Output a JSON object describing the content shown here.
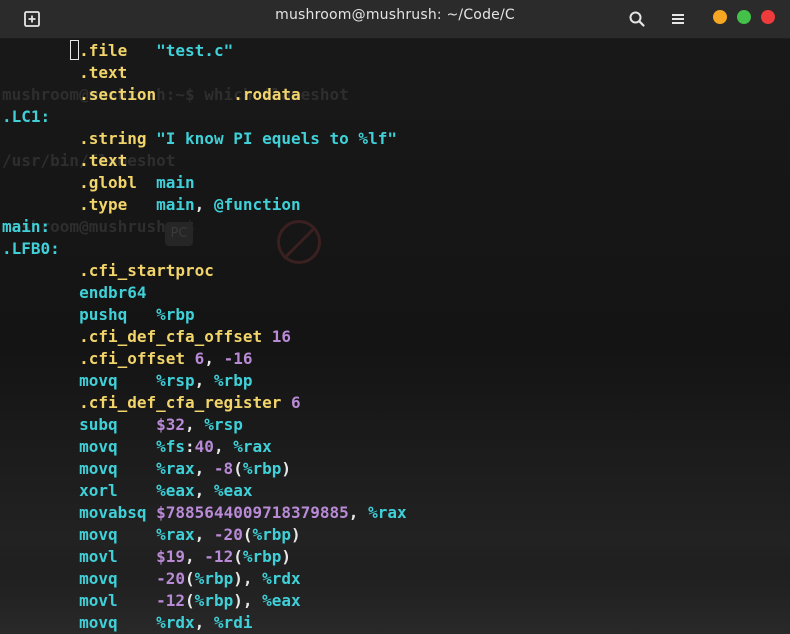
{
  "window": {
    "title": "mushroom@mushrush: ~/Code/C",
    "accent_colors": {
      "minimize": "#f5a623",
      "maximize": "#44c148",
      "close": "#ee3b3b"
    },
    "icons": [
      "new-tab-icon",
      "search-icon",
      "hamburger-menu-icon"
    ]
  },
  "terminal": {
    "background_ghost_text": [
      "mushroom@mushrush:~$ which flameshot",
      "/usr/bin/flameshot",
      "mushroom@mushrush:~$"
    ],
    "lines": [
      [
        [
          "        ",
          "pun"
        ],
        [
          ".file",
          "dir"
        ],
        [
          "   ",
          "pun"
        ],
        [
          "\"test.c\"",
          "str"
        ]
      ],
      [
        [
          "        ",
          "pun"
        ],
        [
          ".text",
          "dir"
        ]
      ],
      [
        [
          "        ",
          "pun"
        ],
        [
          ".section",
          "dir"
        ],
        [
          "        ",
          "pun"
        ],
        [
          ".rodata",
          "dir"
        ]
      ],
      [
        [
          ".LC1:",
          "lab"
        ]
      ],
      [
        [
          "        ",
          "pun"
        ],
        [
          ".string",
          "dir"
        ],
        [
          " ",
          "pun"
        ],
        [
          "\"I know PI equels to %lf\"",
          "str"
        ]
      ],
      [
        [
          "        ",
          "pun"
        ],
        [
          ".text",
          "dir"
        ]
      ],
      [
        [
          "        ",
          "pun"
        ],
        [
          ".globl",
          "dir"
        ],
        [
          "  ",
          "pun"
        ],
        [
          "main",
          "lab"
        ]
      ],
      [
        [
          "        ",
          "pun"
        ],
        [
          ".type",
          "dir"
        ],
        [
          "   ",
          "pun"
        ],
        [
          "main",
          "lab"
        ],
        [
          ", ",
          "pun"
        ],
        [
          "@function",
          "reg"
        ]
      ],
      [
        [
          "main:",
          "lab"
        ]
      ],
      [
        [
          ".LFB0:",
          "lab"
        ]
      ],
      [
        [
          "        ",
          "pun"
        ],
        [
          ".cfi_startproc",
          "dir"
        ]
      ],
      [
        [
          "        ",
          "pun"
        ],
        [
          "endbr64",
          "ins"
        ]
      ],
      [
        [
          "        ",
          "pun"
        ],
        [
          "pushq",
          "ins"
        ],
        [
          "   ",
          "pun"
        ],
        [
          "%rbp",
          "reg"
        ]
      ],
      [
        [
          "        ",
          "pun"
        ],
        [
          ".cfi_def_cfa_offset",
          "dir"
        ],
        [
          " ",
          "pun"
        ],
        [
          "16",
          "num"
        ]
      ],
      [
        [
          "        ",
          "pun"
        ],
        [
          ".cfi_offset",
          "dir"
        ],
        [
          " ",
          "pun"
        ],
        [
          "6",
          "num"
        ],
        [
          ", ",
          "pun"
        ],
        [
          "-16",
          "num"
        ]
      ],
      [
        [
          "        ",
          "pun"
        ],
        [
          "movq",
          "ins"
        ],
        [
          "    ",
          "pun"
        ],
        [
          "%rsp",
          "reg"
        ],
        [
          ", ",
          "pun"
        ],
        [
          "%rbp",
          "reg"
        ]
      ],
      [
        [
          "        ",
          "pun"
        ],
        [
          ".cfi_def_cfa_register",
          "dir"
        ],
        [
          " ",
          "pun"
        ],
        [
          "6",
          "num"
        ]
      ],
      [
        [
          "        ",
          "pun"
        ],
        [
          "subq",
          "ins"
        ],
        [
          "    ",
          "pun"
        ],
        [
          "$32",
          "num"
        ],
        [
          ", ",
          "pun"
        ],
        [
          "%rsp",
          "reg"
        ]
      ],
      [
        [
          "        ",
          "pun"
        ],
        [
          "movq",
          "ins"
        ],
        [
          "    ",
          "pun"
        ],
        [
          "%fs",
          "reg"
        ],
        [
          ":",
          "pun"
        ],
        [
          "40",
          "num"
        ],
        [
          ", ",
          "pun"
        ],
        [
          "%rax",
          "reg"
        ]
      ],
      [
        [
          "        ",
          "pun"
        ],
        [
          "movq",
          "ins"
        ],
        [
          "    ",
          "pun"
        ],
        [
          "%rax",
          "reg"
        ],
        [
          ", ",
          "pun"
        ],
        [
          "-8",
          "num"
        ],
        [
          "(",
          "pun"
        ],
        [
          "%rbp",
          "reg"
        ],
        [
          ")",
          "pun"
        ]
      ],
      [
        [
          "        ",
          "pun"
        ],
        [
          "xorl",
          "ins"
        ],
        [
          "    ",
          "pun"
        ],
        [
          "%eax",
          "reg"
        ],
        [
          ", ",
          "pun"
        ],
        [
          "%eax",
          "reg"
        ]
      ],
      [
        [
          "        ",
          "pun"
        ],
        [
          "movabsq",
          "ins"
        ],
        [
          " ",
          "pun"
        ],
        [
          "$7885644009718379885",
          "num"
        ],
        [
          ", ",
          "pun"
        ],
        [
          "%rax",
          "reg"
        ]
      ],
      [
        [
          "        ",
          "pun"
        ],
        [
          "movq",
          "ins"
        ],
        [
          "    ",
          "pun"
        ],
        [
          "%rax",
          "reg"
        ],
        [
          ", ",
          "pun"
        ],
        [
          "-20",
          "num"
        ],
        [
          "(",
          "pun"
        ],
        [
          "%rbp",
          "reg"
        ],
        [
          ")",
          "pun"
        ]
      ],
      [
        [
          "        ",
          "pun"
        ],
        [
          "movl",
          "ins"
        ],
        [
          "    ",
          "pun"
        ],
        [
          "$19",
          "num"
        ],
        [
          ", ",
          "pun"
        ],
        [
          "-12",
          "num"
        ],
        [
          "(",
          "pun"
        ],
        [
          "%rbp",
          "reg"
        ],
        [
          ")",
          "pun"
        ]
      ],
      [
        [
          "        ",
          "pun"
        ],
        [
          "movq",
          "ins"
        ],
        [
          "    ",
          "pun"
        ],
        [
          "-20",
          "num"
        ],
        [
          "(",
          "pun"
        ],
        [
          "%rbp",
          "reg"
        ],
        [
          "), ",
          "pun"
        ],
        [
          "%rdx",
          "reg"
        ]
      ],
      [
        [
          "        ",
          "pun"
        ],
        [
          "movl",
          "ins"
        ],
        [
          "    ",
          "pun"
        ],
        [
          "-12",
          "num"
        ],
        [
          "(",
          "pun"
        ],
        [
          "%rbp",
          "reg"
        ],
        [
          "), ",
          "pun"
        ],
        [
          "%eax",
          "reg"
        ]
      ],
      [
        [
          "        ",
          "pun"
        ],
        [
          "movq",
          "ins"
        ],
        [
          "    ",
          "pun"
        ],
        [
          "%rdx",
          "reg"
        ],
        [
          ", ",
          "pun"
        ],
        [
          "%rdi",
          "reg"
        ]
      ]
    ]
  }
}
